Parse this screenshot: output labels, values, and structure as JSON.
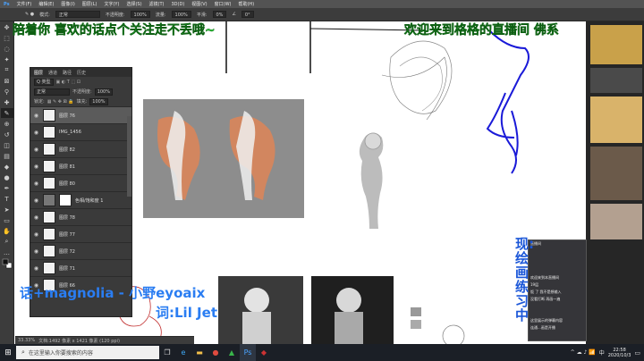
{
  "menubar": {
    "items": [
      "文件(F)",
      "编辑(E)",
      "图像(I)",
      "图层(L)",
      "文字(Y)",
      "选择(S)",
      "滤镜(T)",
      "3D(D)",
      "视图(V)",
      "窗口(W)",
      "帮助(H)"
    ]
  },
  "options": {
    "mode_label": "模式:",
    "mode_value": "正常",
    "opacity_label": "不透明度:",
    "opacity_value": "100%",
    "flow_label": "流量:",
    "flow_value": "100%",
    "smooth_label": "平滑:",
    "smooth_value": "0%",
    "angle_value": "0°"
  },
  "layers_panel": {
    "tabs": [
      "图层",
      "通道",
      "路径",
      "历史"
    ],
    "kind_value": "Q 类型",
    "blend_value": "正常",
    "opacity_label": "不透明度:",
    "opacity_value": "100%",
    "lock_label": "锁定:",
    "fill_label": "填充:",
    "fill_value": "100%",
    "items": [
      {
        "name": "图层 76",
        "active": true
      },
      {
        "name": "IMG_1456",
        "active": false
      },
      {
        "name": "图层 82",
        "active": false
      },
      {
        "name": "图层 81",
        "active": false
      },
      {
        "name": "图层 80",
        "active": false
      },
      {
        "name": "色相/饱和度 1",
        "active": false
      },
      {
        "name": "图层 78",
        "active": false
      },
      {
        "name": "图层 77",
        "active": false
      },
      {
        "name": "图层 72",
        "active": false
      },
      {
        "name": "图层 71",
        "active": false
      },
      {
        "name": "图层 66",
        "active": false
      }
    ]
  },
  "overlay": {
    "top_left": "陪着你 喜欢的话点个关注走不丢哦~",
    "top_right": "欢迎来到格格的直播间  佛系",
    "right_vertical": "现:绘画练习中",
    "song_line1": "话+magnolia - 小野eyoaix",
    "song_line2": "词:Lil Jet"
  },
  "chat": {
    "messages": [
      "直播间",
      "欢迎来到本直播间",
      "19层",
      "饭 了 我不是想输入",
      "没看打断 再画一遍",
      "这里展示的弹幕内容",
      "连通...画是开播"
    ]
  },
  "status": {
    "zoom": "33.33%",
    "doc": "文档:1492 像素 x 1421 像素 (120 ppi)"
  },
  "taskbar": {
    "search_placeholder": "在这里输入你要搜索的内容",
    "time": "22:58",
    "date": "2020/10/3",
    "lang": "中"
  },
  "colors": {
    "accent_green": "#2ccf3a",
    "accent_blue": "#2a7df2",
    "ps_dark": "#3c3c3c"
  }
}
